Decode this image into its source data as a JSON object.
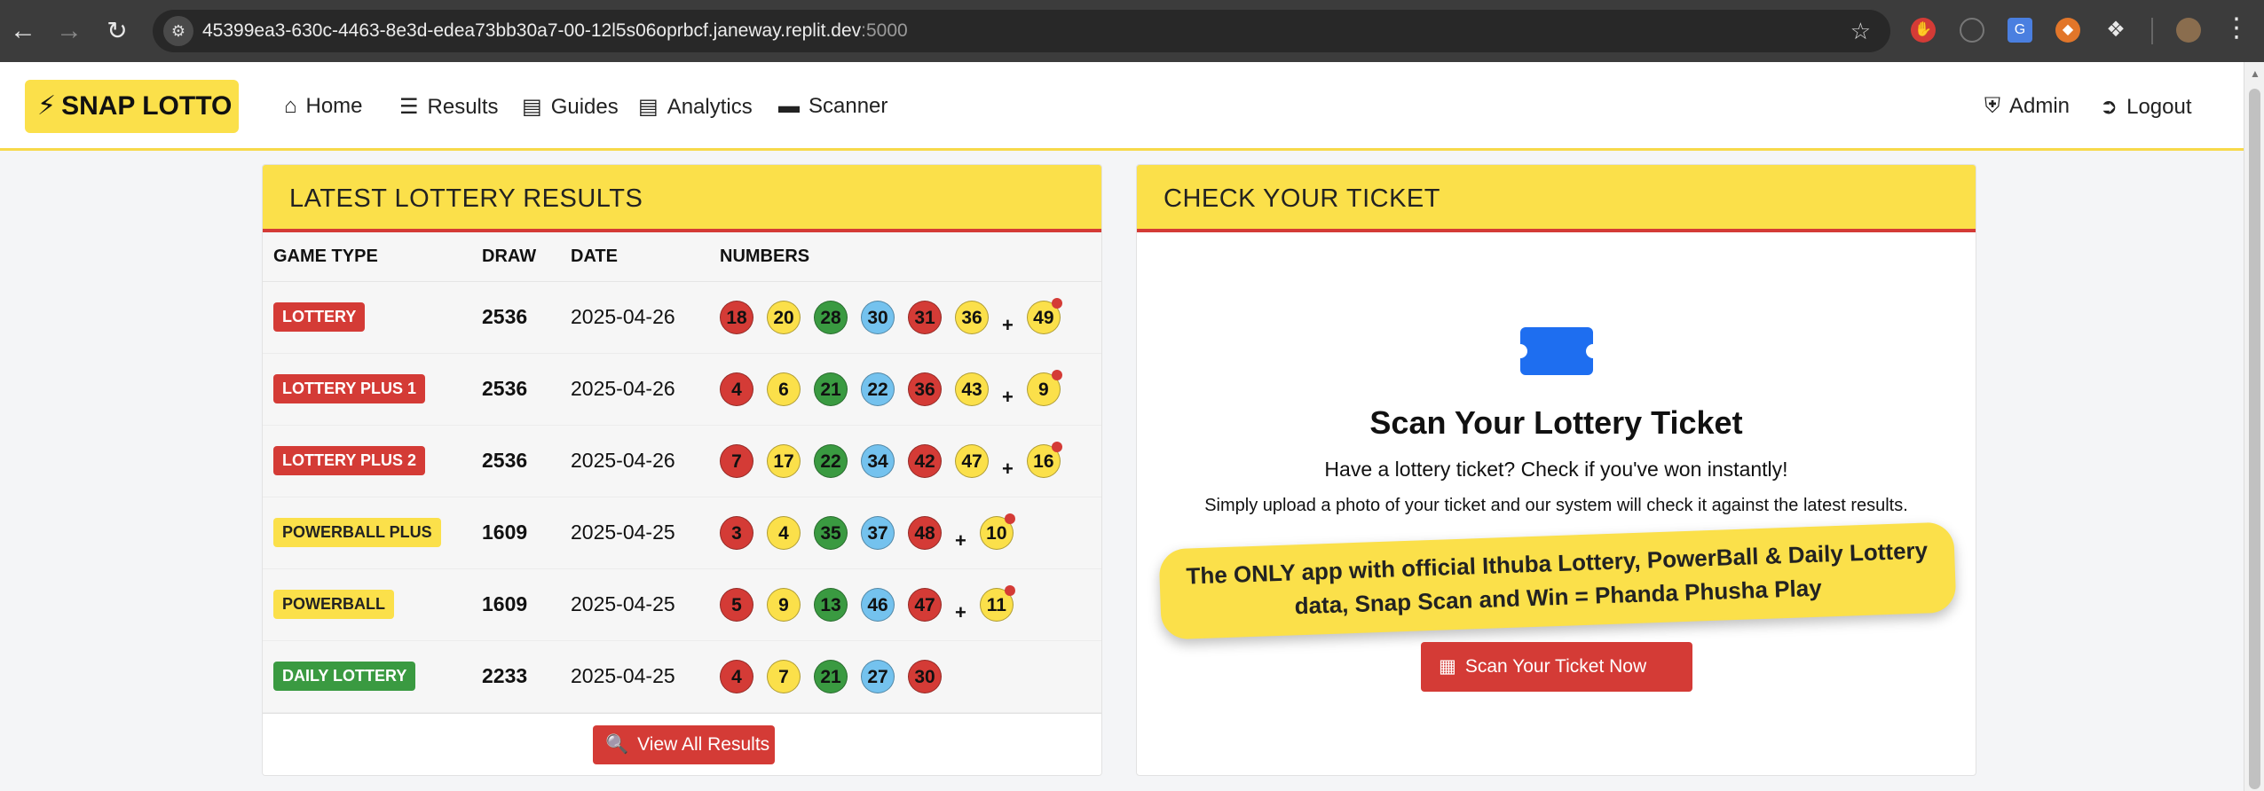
{
  "browser": {
    "url": "45399ea3-630c-4463-8e3d-edea73bb30a7-00-12l5s06oprbcf.janeway.replit.dev",
    "port": ":5000"
  },
  "navbar": {
    "brand": "SNAP LOTTO",
    "links": [
      {
        "label": "Home",
        "icon": "home-icon"
      },
      {
        "label": "Results",
        "icon": "list-icon"
      },
      {
        "label": "Guides",
        "icon": "book-icon"
      },
      {
        "label": "Analytics",
        "icon": "chart-icon"
      },
      {
        "label": "Scanner",
        "icon": "ticket-icon"
      }
    ],
    "right_links": [
      {
        "label": "Admin",
        "icon": "shield-icon"
      },
      {
        "label": "Logout",
        "icon": "logout-icon"
      }
    ]
  },
  "results": {
    "title": "LATEST LOTTERY RESULTS",
    "columns": [
      "GAME TYPE",
      "DRAW",
      "DATE",
      "NUMBERS"
    ],
    "rows": [
      {
        "game": "LOTTERY",
        "badge_color": "#d43b36",
        "draw": "2536",
        "date": "2025-04-26",
        "numbers": [
          "18",
          "20",
          "28",
          "30",
          "31",
          "36"
        ],
        "colors": [
          "red",
          "yellow",
          "green",
          "blue",
          "red",
          "yellow"
        ],
        "bonus": "49"
      },
      {
        "game": "LOTTERY PLUS 1",
        "badge_color": "#d43b36",
        "draw": "2536",
        "date": "2025-04-26",
        "numbers": [
          "4",
          "6",
          "21",
          "22",
          "36",
          "43"
        ],
        "colors": [
          "red",
          "yellow",
          "green",
          "blue",
          "red",
          "yellow"
        ],
        "bonus": "9"
      },
      {
        "game": "LOTTERY PLUS 2",
        "badge_color": "#d43b36",
        "draw": "2536",
        "date": "2025-04-26",
        "numbers": [
          "7",
          "17",
          "22",
          "34",
          "42",
          "47"
        ],
        "colors": [
          "red",
          "yellow",
          "green",
          "blue",
          "red",
          "yellow"
        ],
        "bonus": "16"
      },
      {
        "game": "POWERBALL PLUS",
        "badge_color": "#fbe04a",
        "draw": "1609",
        "date": "2025-04-25",
        "numbers": [
          "3",
          "4",
          "35",
          "37",
          "48"
        ],
        "colors": [
          "red",
          "yellow",
          "green",
          "blue",
          "red"
        ],
        "bonus": "10"
      },
      {
        "game": "POWERBALL",
        "badge_color": "#fbe04a",
        "draw": "1609",
        "date": "2025-04-25",
        "numbers": [
          "5",
          "9",
          "13",
          "46",
          "47"
        ],
        "colors": [
          "red",
          "yellow",
          "green",
          "blue",
          "red"
        ],
        "bonus": "11"
      },
      {
        "game": "DAILY LOTTERY",
        "badge_color": "#3a9a41",
        "draw": "2233",
        "date": "2025-04-25",
        "numbers": [
          "4",
          "7",
          "21",
          "27",
          "30"
        ],
        "colors": [
          "red",
          "yellow",
          "green",
          "blue",
          "red"
        ],
        "bonus": null
      }
    ],
    "bonus_separator": "+",
    "view_all_label": "View All Results"
  },
  "ticket": {
    "title": "CHECK YOUR TICKET",
    "heading": "Scan Your Lottery Ticket",
    "subheading": "Have a lottery ticket? Check if you've won instantly!",
    "description": "Simply upload a photo of your ticket and our system will check it against the latest results.",
    "promo_line1": "The ONLY app with official Ithuba Lottery, PowerBall & Daily Lottery",
    "promo_line2": "data, Snap Scan and Win = Phanda Phusha Play",
    "button_label": "Scan Your Ticket Now"
  }
}
